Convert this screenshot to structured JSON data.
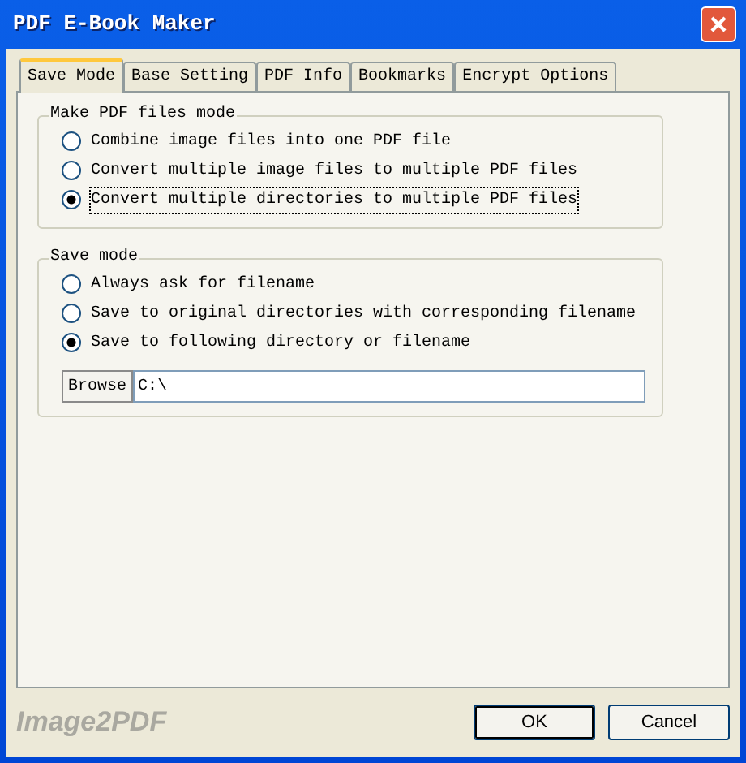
{
  "window": {
    "title": "PDF E-Book Maker"
  },
  "tabs": [
    {
      "label": "Save Mode",
      "selected": true
    },
    {
      "label": "Base Setting",
      "selected": false
    },
    {
      "label": "PDF Info",
      "selected": false
    },
    {
      "label": "Bookmarks",
      "selected": false
    },
    {
      "label": "Encrypt Options",
      "selected": false
    }
  ],
  "make_mode": {
    "title": "Make PDF files mode",
    "options": [
      {
        "label": "Combine image files into one PDF file",
        "selected": false
      },
      {
        "label": "Convert multiple image files to multiple PDF files",
        "selected": false
      },
      {
        "label": "Convert multiple directories to multiple PDF files",
        "selected": true
      }
    ]
  },
  "save_mode": {
    "title": "Save mode",
    "options": [
      {
        "label": "Always ask for filename",
        "selected": false
      },
      {
        "label": "Save to original directories with corresponding filename",
        "selected": false
      },
      {
        "label": "Save to following directory or filename",
        "selected": true
      }
    ],
    "browse_button": "Browse",
    "path": "C:\\"
  },
  "brand": "Image2PDF",
  "buttons": [
    {
      "label": "OK",
      "default": true
    },
    {
      "label": "Cancel",
      "default": false
    }
  ]
}
